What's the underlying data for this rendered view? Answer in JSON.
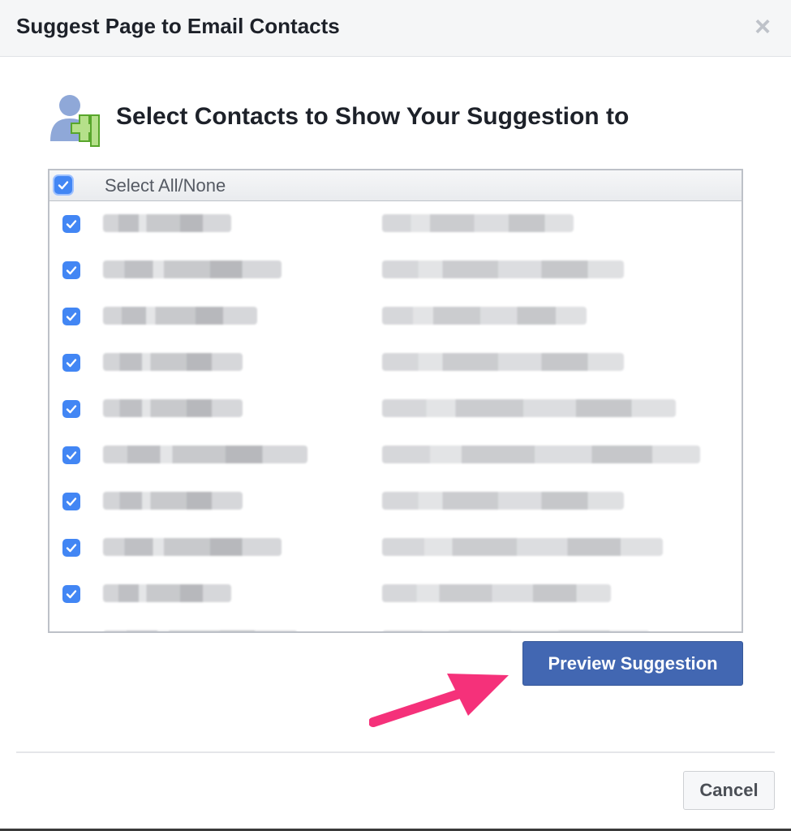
{
  "dialog": {
    "title": "Suggest Page to Email Contacts",
    "close_icon": "close-icon"
  },
  "heading": {
    "icon": "add-contact-icon",
    "text": "Select Contacts to Show Your Suggestion to"
  },
  "list": {
    "select_all_label": "Select All/None",
    "select_all_checked": true,
    "rows": [
      {
        "checked": true,
        "name_blurred": true,
        "email_blurred": true
      },
      {
        "checked": true,
        "name_blurred": true,
        "email_blurred": true
      },
      {
        "checked": true,
        "name_blurred": true,
        "email_blurred": true
      },
      {
        "checked": true,
        "name_blurred": true,
        "email_blurred": true
      },
      {
        "checked": true,
        "name_blurred": true,
        "email_blurred": true
      },
      {
        "checked": true,
        "name_blurred": true,
        "email_blurred": true
      },
      {
        "checked": true,
        "name_blurred": true,
        "email_blurred": true
      },
      {
        "checked": true,
        "name_blurred": true,
        "email_blurred": true
      },
      {
        "checked": true,
        "name_blurred": true,
        "email_blurred": true
      },
      {
        "checked": true,
        "name_blurred": true,
        "email_blurred": true
      }
    ]
  },
  "actions": {
    "preview_label": "Preview Suggestion",
    "cancel_label": "Cancel"
  },
  "annotation": {
    "arrow_icon": "pink-arrow-icon"
  },
  "colors": {
    "primary_button": "#4267b2",
    "checkbox": "#4286f4",
    "arrow": "#f5317a"
  }
}
